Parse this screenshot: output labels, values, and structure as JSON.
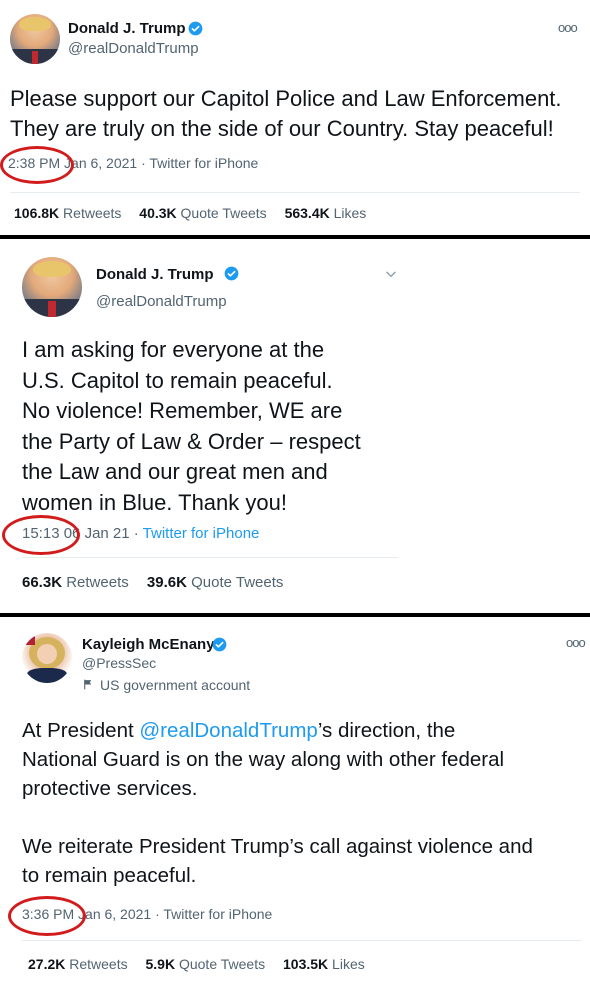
{
  "tweet1": {
    "name": "Donald J. Trump",
    "handle": "@realDonaldTrump",
    "text": "Please support our Capitol Police and Law Enforcement.\nThey are truly on the side of our Country. Stay peaceful!",
    "time": "2:38 PM",
    "date": "Jan 6, 2021",
    "source": "Twitter for iPhone",
    "retweets": "106.8K",
    "retweets_label": "Retweets",
    "quotes": "40.3K",
    "quotes_label": "Quote Tweets",
    "likes": "563.4K",
    "likes_label": "Likes"
  },
  "tweet2": {
    "name": "Donald J. Trump",
    "handle": "@realDonaldTrump",
    "text": "I am asking for everyone at the\nU.S. Capitol to remain peaceful.\nNo violence! Remember, WE are\nthe Party of Law & Order – respect\nthe Law and our great men and\nwomen in Blue. Thank you!",
    "time": "15:13",
    "date": "06 Jan 21",
    "source": "Twitter for iPhone",
    "retweets": "66.3K",
    "retweets_label": "Retweets",
    "quotes": "39.6K",
    "quotes_label": "Quote Tweets"
  },
  "tweet3": {
    "name": "Kayleigh McEnany",
    "handle": "@PressSec",
    "gov_label": "US government account",
    "text_prefix": "At President ",
    "mention": "@realDonaldTrump",
    "text_suffix": "’s direction, the\nNational Guard is on the way along with other federal\nprotective services.\n\nWe reiterate President Trump’s call against violence and\nto remain peaceful.",
    "time": "3:36 PM",
    "date": "Jan 6, 2021",
    "source": "Twitter for iPhone",
    "retweets": "27.2K",
    "retweets_label": "Retweets",
    "quotes": "5.9K",
    "quotes_label": "Quote Tweets",
    "likes": "103.5K",
    "likes_label": "Likes"
  },
  "colors": {
    "accent": "#1d9bf0",
    "highlight_circle": "#d21c1c",
    "separator": "#000000"
  },
  "icons": [
    "verified-badge-icon",
    "more-options-icon",
    "chevron-down-icon",
    "government-flag-icon"
  ]
}
